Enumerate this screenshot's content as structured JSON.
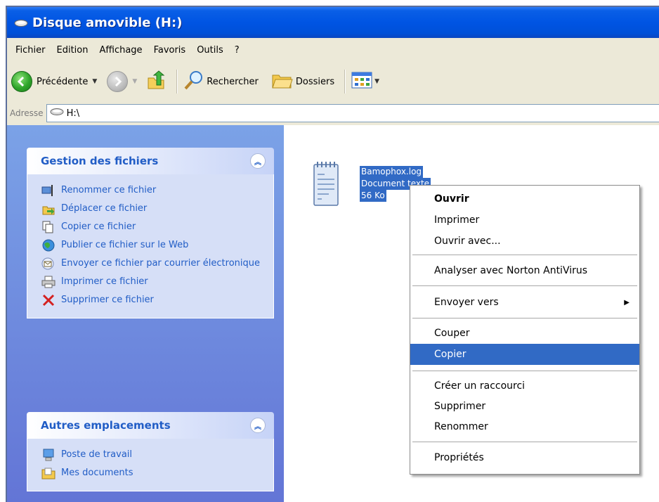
{
  "window": {
    "title": "Disque amovible (H:)",
    "colors": {
      "titlebar": "#0054e3",
      "chrome": "#ece9d8",
      "task_link": "#215dc6",
      "selection": "#316ac5"
    }
  },
  "menubar": [
    "Fichier",
    "Edition",
    "Affichage",
    "Favoris",
    "Outils",
    "?"
  ],
  "toolbar": {
    "back_label": "Précédente",
    "search_label": "Rechercher",
    "folders_label": "Dossiers"
  },
  "address": {
    "label": "Adresse",
    "value": "H:\\"
  },
  "task_pane": {
    "file_tasks": {
      "title": "Gestion des fichiers",
      "items": [
        {
          "label": "Renommer ce fichier",
          "icon": "rename-icon"
        },
        {
          "label": "Déplacer ce fichier",
          "icon": "move-icon"
        },
        {
          "label": "Copier ce fichier",
          "icon": "copy-icon"
        },
        {
          "label": "Publier ce fichier sur le Web",
          "icon": "publish-web-icon"
        },
        {
          "label": "Envoyer ce fichier par courrier électronique",
          "icon": "email-icon"
        },
        {
          "label": "Imprimer ce fichier",
          "icon": "print-icon"
        },
        {
          "label": "Supprimer ce fichier",
          "icon": "delete-icon"
        }
      ]
    },
    "other_places": {
      "title": "Autres emplacements",
      "items": [
        {
          "label": "Poste de travail",
          "icon": "computer-icon"
        },
        {
          "label": "Mes documents",
          "icon": "documents-folder-icon"
        }
      ]
    }
  },
  "file": {
    "name": "Bamophox.log",
    "type": "Document texte",
    "size": "56 Ko"
  },
  "context_menu": {
    "items": [
      {
        "label": "Ouvrir",
        "bold": true
      },
      {
        "label": "Imprimer"
      },
      {
        "label": "Ouvrir avec..."
      },
      {
        "separator": true
      },
      {
        "label": "Analyser avec Norton AntiVirus"
      },
      {
        "separator": true
      },
      {
        "label": "Envoyer vers",
        "submenu": true
      },
      {
        "separator": true
      },
      {
        "label": "Couper"
      },
      {
        "label": "Copier",
        "highlighted": true
      },
      {
        "separator": true
      },
      {
        "label": "Créer un raccourci"
      },
      {
        "label": "Supprimer"
      },
      {
        "label": "Renommer"
      },
      {
        "separator": true
      },
      {
        "label": "Propriétés"
      }
    ]
  }
}
